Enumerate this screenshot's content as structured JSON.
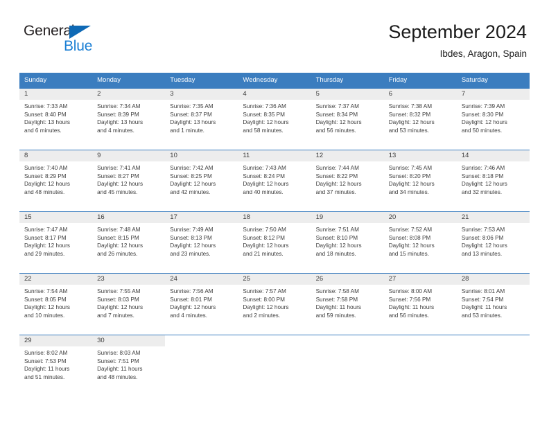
{
  "brand": {
    "name_part1": "General",
    "name_part2": "Blue",
    "accent_color": "#1b7fd4",
    "triangle_color": "#0e69b5"
  },
  "header": {
    "title": "September 2024",
    "subtitle": "Ibdes, Aragon, Spain",
    "header_bg_color": "#3b7dbf",
    "daynum_band_color": "#ededed"
  },
  "weekday_headers": [
    "Sunday",
    "Monday",
    "Tuesday",
    "Wednesday",
    "Thursday",
    "Friday",
    "Saturday"
  ],
  "weeks": [
    [
      {
        "day": "1",
        "sunrise": "Sunrise: 7:33 AM",
        "sunset": "Sunset: 8:40 PM",
        "daylight_line1": "Daylight: 13 hours",
        "daylight_line2": "and 6 minutes."
      },
      {
        "day": "2",
        "sunrise": "Sunrise: 7:34 AM",
        "sunset": "Sunset: 8:39 PM",
        "daylight_line1": "Daylight: 13 hours",
        "daylight_line2": "and 4 minutes."
      },
      {
        "day": "3",
        "sunrise": "Sunrise: 7:35 AM",
        "sunset": "Sunset: 8:37 PM",
        "daylight_line1": "Daylight: 13 hours",
        "daylight_line2": "and 1 minute."
      },
      {
        "day": "4",
        "sunrise": "Sunrise: 7:36 AM",
        "sunset": "Sunset: 8:35 PM",
        "daylight_line1": "Daylight: 12 hours",
        "daylight_line2": "and 58 minutes."
      },
      {
        "day": "5",
        "sunrise": "Sunrise: 7:37 AM",
        "sunset": "Sunset: 8:34 PM",
        "daylight_line1": "Daylight: 12 hours",
        "daylight_line2": "and 56 minutes."
      },
      {
        "day": "6",
        "sunrise": "Sunrise: 7:38 AM",
        "sunset": "Sunset: 8:32 PM",
        "daylight_line1": "Daylight: 12 hours",
        "daylight_line2": "and 53 minutes."
      },
      {
        "day": "7",
        "sunrise": "Sunrise: 7:39 AM",
        "sunset": "Sunset: 8:30 PM",
        "daylight_line1": "Daylight: 12 hours",
        "daylight_line2": "and 50 minutes."
      }
    ],
    [
      {
        "day": "8",
        "sunrise": "Sunrise: 7:40 AM",
        "sunset": "Sunset: 8:29 PM",
        "daylight_line1": "Daylight: 12 hours",
        "daylight_line2": "and 48 minutes."
      },
      {
        "day": "9",
        "sunrise": "Sunrise: 7:41 AM",
        "sunset": "Sunset: 8:27 PM",
        "daylight_line1": "Daylight: 12 hours",
        "daylight_line2": "and 45 minutes."
      },
      {
        "day": "10",
        "sunrise": "Sunrise: 7:42 AM",
        "sunset": "Sunset: 8:25 PM",
        "daylight_line1": "Daylight: 12 hours",
        "daylight_line2": "and 42 minutes."
      },
      {
        "day": "11",
        "sunrise": "Sunrise: 7:43 AM",
        "sunset": "Sunset: 8:24 PM",
        "daylight_line1": "Daylight: 12 hours",
        "daylight_line2": "and 40 minutes."
      },
      {
        "day": "12",
        "sunrise": "Sunrise: 7:44 AM",
        "sunset": "Sunset: 8:22 PM",
        "daylight_line1": "Daylight: 12 hours",
        "daylight_line2": "and 37 minutes."
      },
      {
        "day": "13",
        "sunrise": "Sunrise: 7:45 AM",
        "sunset": "Sunset: 8:20 PM",
        "daylight_line1": "Daylight: 12 hours",
        "daylight_line2": "and 34 minutes."
      },
      {
        "day": "14",
        "sunrise": "Sunrise: 7:46 AM",
        "sunset": "Sunset: 8:18 PM",
        "daylight_line1": "Daylight: 12 hours",
        "daylight_line2": "and 32 minutes."
      }
    ],
    [
      {
        "day": "15",
        "sunrise": "Sunrise: 7:47 AM",
        "sunset": "Sunset: 8:17 PM",
        "daylight_line1": "Daylight: 12 hours",
        "daylight_line2": "and 29 minutes."
      },
      {
        "day": "16",
        "sunrise": "Sunrise: 7:48 AM",
        "sunset": "Sunset: 8:15 PM",
        "daylight_line1": "Daylight: 12 hours",
        "daylight_line2": "and 26 minutes."
      },
      {
        "day": "17",
        "sunrise": "Sunrise: 7:49 AM",
        "sunset": "Sunset: 8:13 PM",
        "daylight_line1": "Daylight: 12 hours",
        "daylight_line2": "and 23 minutes."
      },
      {
        "day": "18",
        "sunrise": "Sunrise: 7:50 AM",
        "sunset": "Sunset: 8:12 PM",
        "daylight_line1": "Daylight: 12 hours",
        "daylight_line2": "and 21 minutes."
      },
      {
        "day": "19",
        "sunrise": "Sunrise: 7:51 AM",
        "sunset": "Sunset: 8:10 PM",
        "daylight_line1": "Daylight: 12 hours",
        "daylight_line2": "and 18 minutes."
      },
      {
        "day": "20",
        "sunrise": "Sunrise: 7:52 AM",
        "sunset": "Sunset: 8:08 PM",
        "daylight_line1": "Daylight: 12 hours",
        "daylight_line2": "and 15 minutes."
      },
      {
        "day": "21",
        "sunrise": "Sunrise: 7:53 AM",
        "sunset": "Sunset: 8:06 PM",
        "daylight_line1": "Daylight: 12 hours",
        "daylight_line2": "and 13 minutes."
      }
    ],
    [
      {
        "day": "22",
        "sunrise": "Sunrise: 7:54 AM",
        "sunset": "Sunset: 8:05 PM",
        "daylight_line1": "Daylight: 12 hours",
        "daylight_line2": "and 10 minutes."
      },
      {
        "day": "23",
        "sunrise": "Sunrise: 7:55 AM",
        "sunset": "Sunset: 8:03 PM",
        "daylight_line1": "Daylight: 12 hours",
        "daylight_line2": "and 7 minutes."
      },
      {
        "day": "24",
        "sunrise": "Sunrise: 7:56 AM",
        "sunset": "Sunset: 8:01 PM",
        "daylight_line1": "Daylight: 12 hours",
        "daylight_line2": "and 4 minutes."
      },
      {
        "day": "25",
        "sunrise": "Sunrise: 7:57 AM",
        "sunset": "Sunset: 8:00 PM",
        "daylight_line1": "Daylight: 12 hours",
        "daylight_line2": "and 2 minutes."
      },
      {
        "day": "26",
        "sunrise": "Sunrise: 7:58 AM",
        "sunset": "Sunset: 7:58 PM",
        "daylight_line1": "Daylight: 11 hours",
        "daylight_line2": "and 59 minutes."
      },
      {
        "day": "27",
        "sunrise": "Sunrise: 8:00 AM",
        "sunset": "Sunset: 7:56 PM",
        "daylight_line1": "Daylight: 11 hours",
        "daylight_line2": "and 56 minutes."
      },
      {
        "day": "28",
        "sunrise": "Sunrise: 8:01 AM",
        "sunset": "Sunset: 7:54 PM",
        "daylight_line1": "Daylight: 11 hours",
        "daylight_line2": "and 53 minutes."
      }
    ],
    [
      {
        "day": "29",
        "sunrise": "Sunrise: 8:02 AM",
        "sunset": "Sunset: 7:53 PM",
        "daylight_line1": "Daylight: 11 hours",
        "daylight_line2": "and 51 minutes."
      },
      {
        "day": "30",
        "sunrise": "Sunrise: 8:03 AM",
        "sunset": "Sunset: 7:51 PM",
        "daylight_line1": "Daylight: 11 hours",
        "daylight_line2": "and 48 minutes."
      },
      {
        "day": "",
        "sunrise": "",
        "sunset": "",
        "daylight_line1": "",
        "daylight_line2": ""
      },
      {
        "day": "",
        "sunrise": "",
        "sunset": "",
        "daylight_line1": "",
        "daylight_line2": ""
      },
      {
        "day": "",
        "sunrise": "",
        "sunset": "",
        "daylight_line1": "",
        "daylight_line2": ""
      },
      {
        "day": "",
        "sunrise": "",
        "sunset": "",
        "daylight_line1": "",
        "daylight_line2": ""
      },
      {
        "day": "",
        "sunrise": "",
        "sunset": "",
        "daylight_line1": "",
        "daylight_line2": ""
      }
    ]
  ]
}
